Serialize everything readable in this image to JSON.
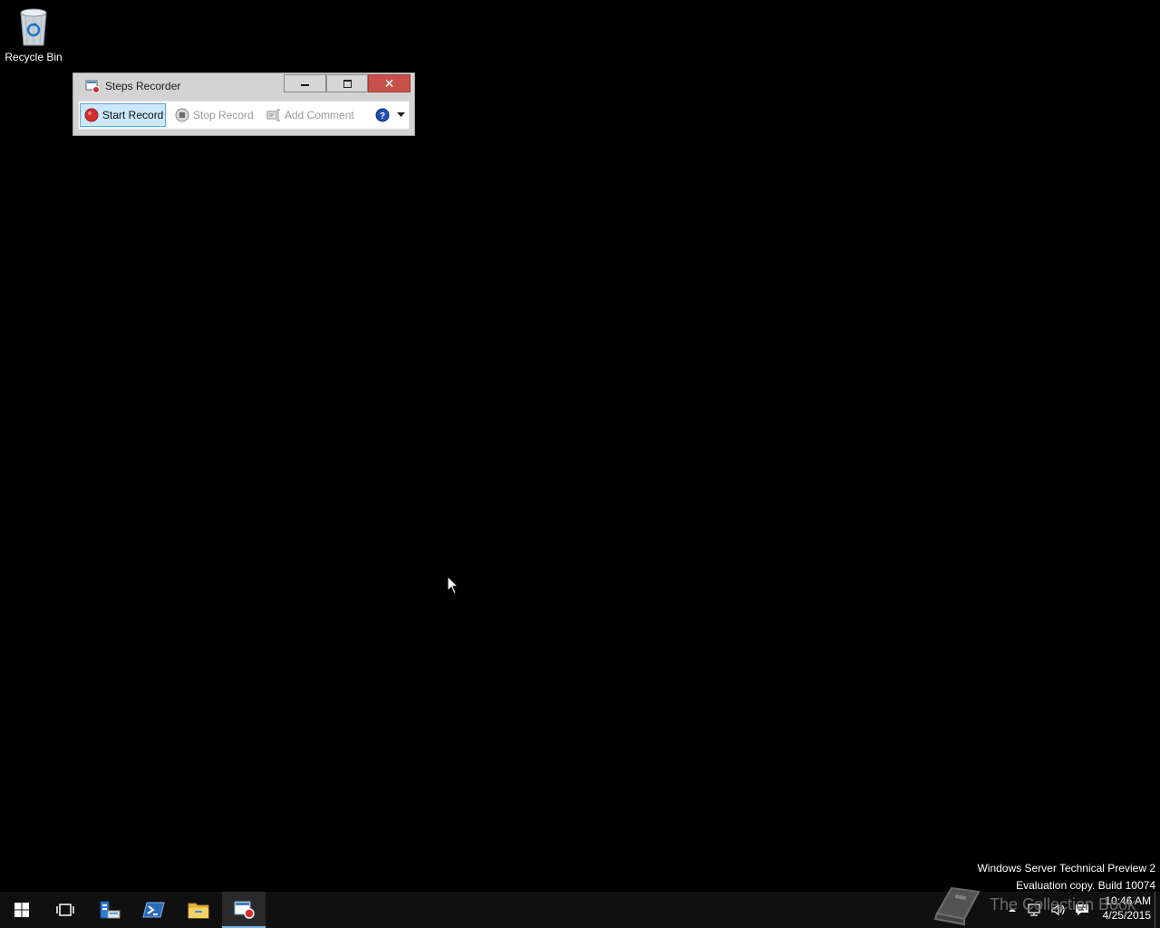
{
  "desktop": {
    "icons": [
      {
        "label": "Recycle Bin",
        "icon": "recycle-bin-icon"
      }
    ]
  },
  "window": {
    "title": "Steps Recorder",
    "icon": "steps-recorder-icon",
    "caption": {
      "minimize": "minimize-icon",
      "maximize": "maximize-icon",
      "close": "✕"
    },
    "toolbar": {
      "start_record": "Start Record",
      "stop_record": "Stop Record",
      "add_comment": "Add Comment",
      "help_icon": "help-icon",
      "dropdown_icon": "chevron-down-icon"
    }
  },
  "watermark": {
    "line1": "Windows Server Technical Preview 2",
    "line2": "Evaluation copy. Build 10074"
  },
  "overlay_logo": {
    "text": "The Collection Book"
  },
  "taskbar": {
    "items": [
      {
        "name": "start-button",
        "icon": "windows-logo-icon"
      },
      {
        "name": "task-view-button",
        "icon": "task-view-icon"
      },
      {
        "name": "server-manager-button",
        "icon": "server-manager-icon"
      },
      {
        "name": "powershell-button",
        "icon": "powershell-icon"
      },
      {
        "name": "file-explorer-button",
        "icon": "folder-icon"
      },
      {
        "name": "steps-recorder-taskbar-button",
        "icon": "steps-recorder-icon",
        "active": true
      }
    ],
    "tray": {
      "icons": [
        "chevron-up-icon",
        "network-icon",
        "volume-icon",
        "action-center-icon"
      ],
      "time": "10:46 AM",
      "date": "4/25/2015"
    }
  },
  "colors": {
    "desktop": "#000000",
    "close_button": "#c7504a",
    "active_toolbar_button": "#cce8ff",
    "taskbar_accent": "#76b9ed"
  }
}
